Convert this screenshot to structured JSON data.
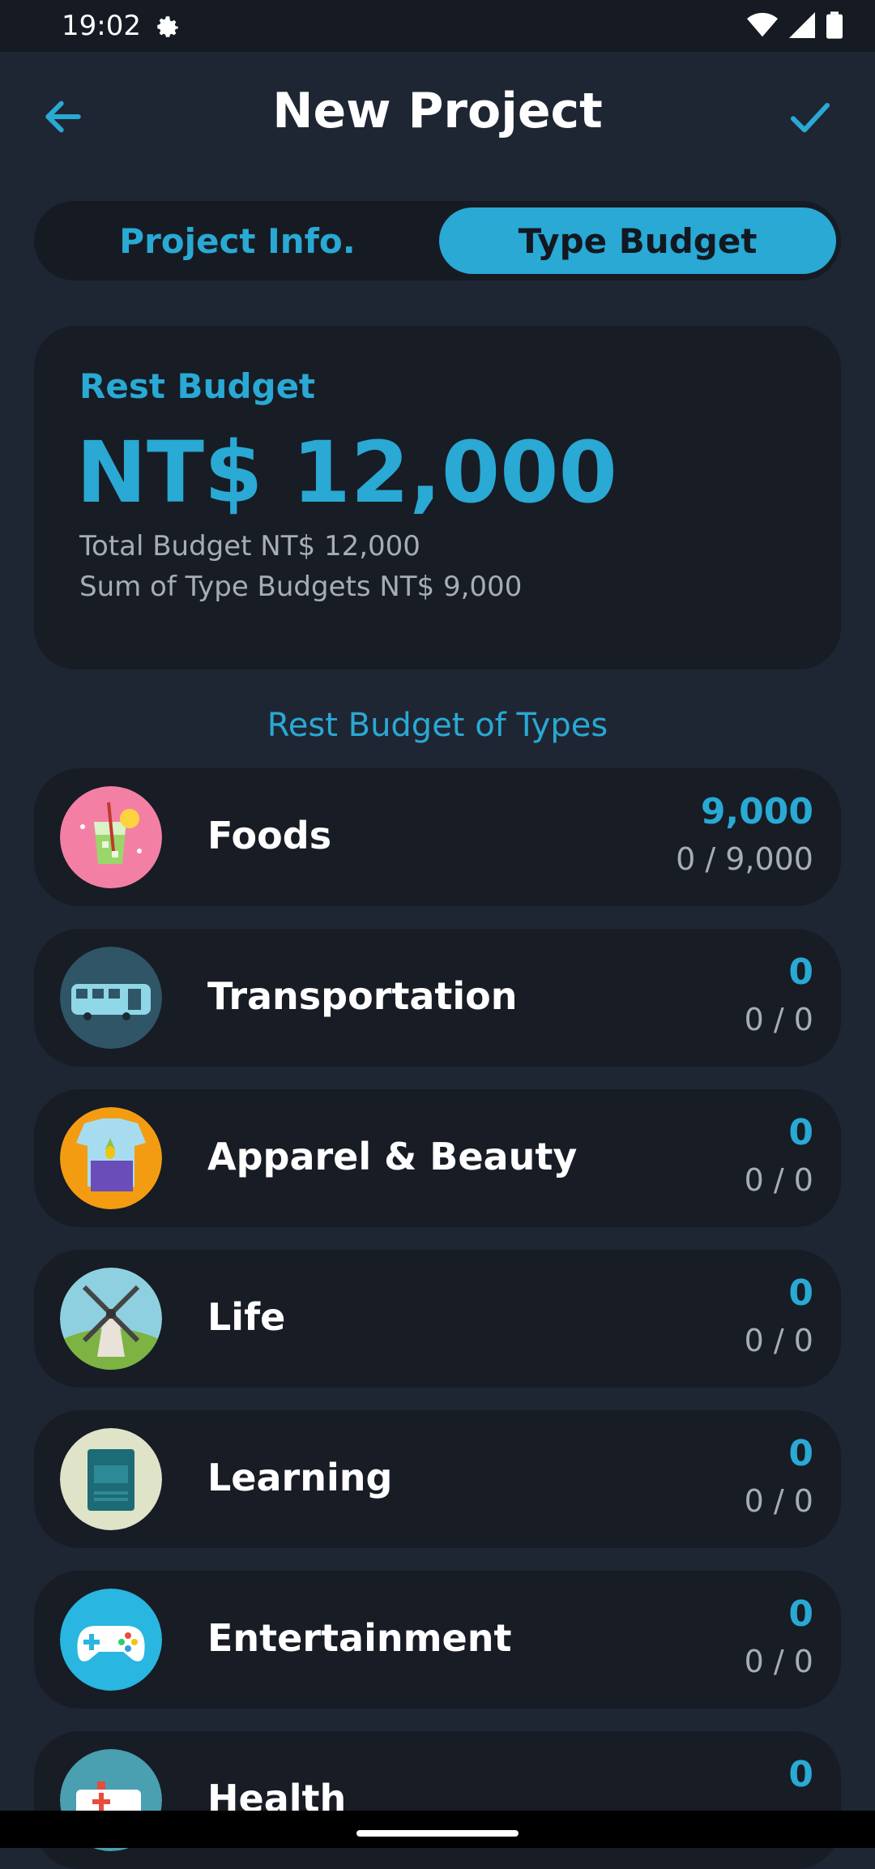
{
  "status_bar": {
    "time": "19:02"
  },
  "app_bar": {
    "title": "New Project"
  },
  "tabs": [
    {
      "label": "Project Info.",
      "active": false
    },
    {
      "label": "Type Budget",
      "active": true
    }
  ],
  "rest_budget": {
    "label": "Rest Budget",
    "amount": "NT$ 12,000",
    "total_line": "Total Budget NT$ 12,000",
    "sum_line": "Sum of Type Budgets NT$ 9,000"
  },
  "types_section_title": "Rest Budget of Types",
  "types": [
    {
      "name": "Foods",
      "rest": "9,000",
      "used": "0 / 9,000",
      "icon": "drink-icon"
    },
    {
      "name": "Transportation",
      "rest": "0",
      "used": "0 / 0",
      "icon": "bus-icon"
    },
    {
      "name": "Apparel & Beauty",
      "rest": "0",
      "used": "0 / 0",
      "icon": "clothes-icon"
    },
    {
      "name": "Life",
      "rest": "0",
      "used": "0 / 0",
      "icon": "windmill-icon"
    },
    {
      "name": "Learning",
      "rest": "0",
      "used": "0 / 0",
      "icon": "book-icon"
    },
    {
      "name": "Entertainment",
      "rest": "0",
      "used": "0 / 0",
      "icon": "gamepad-icon"
    },
    {
      "name": "Health",
      "rest": "0",
      "used": "",
      "icon": "ambulance-icon"
    }
  ],
  "colors": {
    "accent": "#29a9d4",
    "background": "#1f2633",
    "card": "#171c25",
    "muted_text": "#a7adb7"
  }
}
